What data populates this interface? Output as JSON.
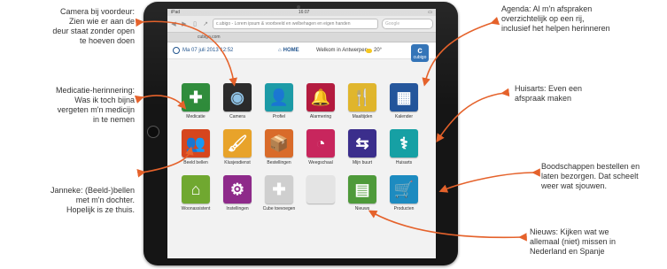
{
  "colors": {
    "arrow": "#e5622b"
  },
  "annotations": {
    "camera": [
      "Camera bij voordeur:",
      "Zien wie er aan de",
      "deur staat zonder open",
      "te hoeven doen"
    ],
    "medicatie": [
      "Medicatie-herinnering:",
      "Was ik toch bijna",
      "vergeten m'n medicijn",
      "in te nemen"
    ],
    "janneke": [
      "Janneke: (Beeld-)bellen",
      "met m'n dochter.",
      "Hopelijk is ze thuis."
    ],
    "agenda": [
      "Agenda: Al m'n afspraken",
      "overzichtelijk op een rij,",
      "inclusief het helpen herinneren"
    ],
    "huisarts": [
      "Huisarts: Even een",
      "afspraak maken"
    ],
    "boodschappen": [
      "Boodschappen bestellen en",
      "laten bezorgen. Dat scheelt",
      "weer wat sjouwen."
    ],
    "nieuws": [
      "Nieuws: Kijken wat we",
      "allemaal (niet) missen in",
      "Nederland en Spanje"
    ]
  },
  "browser": {
    "status_left": "iPad",
    "status_time": "16:07",
    "tab_title": "cubigo.com",
    "url": "c.ubigo - Lorem ipsum & voorbeeld en welbehagen en eigen handen",
    "search_placeholder": "Google"
  },
  "app": {
    "date": "Ma 07 juli 2013 12:52",
    "home_label": "HOME",
    "welcome": "Welkom in Antwerpen",
    "temperature": "20°",
    "logo_text": "cubigo",
    "logo_letter": "c"
  },
  "tiles": [
    {
      "label": "Medicatie",
      "icon": "plus-icon",
      "glyph": "✚",
      "color": "#2e8b3a"
    },
    {
      "label": "Camera",
      "icon": "camera-icon",
      "glyph": "◉",
      "color": "#2a2a2a"
    },
    {
      "label": "Profiel",
      "icon": "person-icon",
      "glyph": "👤",
      "color": "#1a9aa6"
    },
    {
      "label": "Alarmering",
      "icon": "bell-icon",
      "glyph": "🔔",
      "color": "#b3193d"
    },
    {
      "label": "Maaltijden",
      "icon": "cutlery-icon",
      "glyph": "🍴",
      "color": "#e0b52b"
    },
    {
      "label": "Kalender",
      "icon": "calendar-icon",
      "glyph": "▦",
      "color": "#22549a"
    },
    {
      "label": "Beeld bellen",
      "icon": "people-icon",
      "glyph": "👥",
      "color": "#d6461e"
    },
    {
      "label": "Klusjesdienst",
      "icon": "paint-roller-icon",
      "glyph": "🖌",
      "color": "#e8a32a"
    },
    {
      "label": "Bestellingen",
      "icon": "box-icon",
      "glyph": "📦",
      "color": "#d96b2a"
    },
    {
      "label": "Weegschaal",
      "icon": "scale-icon",
      "glyph": "◔",
      "color": "#c8265d"
    },
    {
      "label": "Mijn buurt",
      "icon": "signpost-icon",
      "glyph": "⇆",
      "color": "#3b2e8c"
    },
    {
      "label": "Huisarts",
      "icon": "stethoscope-icon",
      "glyph": "⚕",
      "color": "#16a0a4"
    },
    {
      "label": "Woonassistent",
      "icon": "house-icon",
      "glyph": "⌂",
      "color": "#70a830"
    },
    {
      "label": "Instellingen",
      "icon": "gear-icon",
      "glyph": "⚙",
      "color": "#8e2a8a"
    },
    {
      "label": "Cube toevoegen",
      "icon": "add-icon",
      "glyph": "✚",
      "color": "#cfcfcf"
    },
    {
      "label": "",
      "icon": "empty-slot-icon",
      "glyph": "",
      "color": "#e4e4e4"
    },
    {
      "label": "Nieuws",
      "icon": "newspaper-icon",
      "glyph": "▤",
      "color": "#4e9a3a"
    },
    {
      "label": "Producten",
      "icon": "cart-icon",
      "glyph": "🛒",
      "color": "#1d8bc0"
    }
  ]
}
